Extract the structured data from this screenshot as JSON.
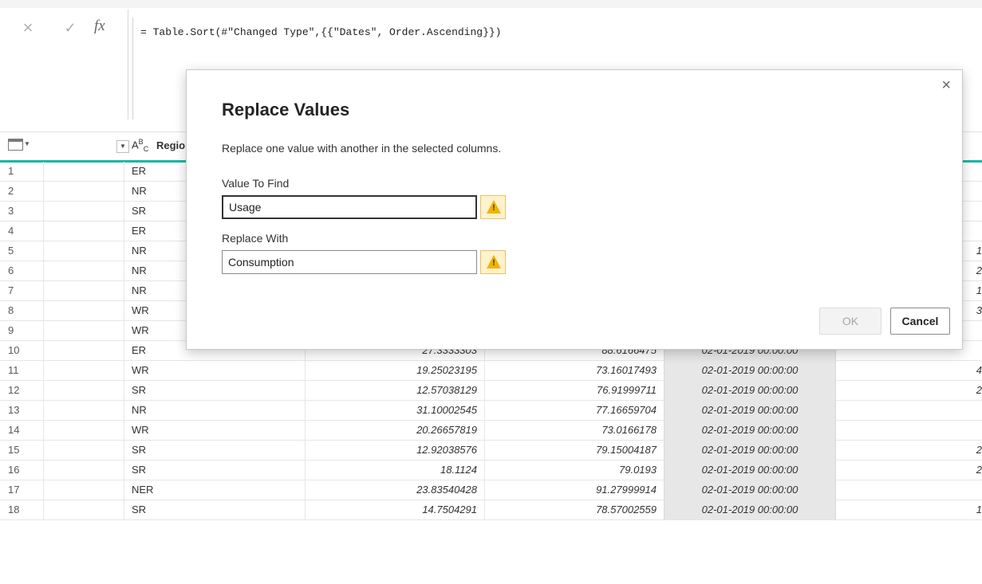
{
  "formula_bar": {
    "cancel_icon": "×",
    "commit_icon": "✓",
    "fx_label": "fx",
    "formula": "= Table.Sort(#\"Changed Type\",{{\"Dates\", Order.Ascending}})"
  },
  "header": {
    "region_type": "ABC",
    "region_label": "Regio"
  },
  "rows": [
    {
      "n": "1",
      "region": "ER",
      "v1": "",
      "v2": "",
      "date": "",
      "last": ""
    },
    {
      "n": "2",
      "region": "NR",
      "v1": "",
      "v2": "",
      "date": "",
      "last": ""
    },
    {
      "n": "3",
      "region": "SR",
      "v1": "",
      "v2": "",
      "date": "",
      "last": ""
    },
    {
      "n": "4",
      "region": "ER",
      "v1": "",
      "v2": "",
      "date": "",
      "last": ""
    },
    {
      "n": "5",
      "region": "NR",
      "v1": "",
      "v2": "",
      "date": "",
      "last": "1"
    },
    {
      "n": "6",
      "region": "NR",
      "v1": "",
      "v2": "",
      "date": "",
      "last": "2"
    },
    {
      "n": "7",
      "region": "NR",
      "v1": "",
      "v2": "",
      "date": "",
      "last": "1"
    },
    {
      "n": "8",
      "region": "WR",
      "v1": "",
      "v2": "",
      "date": "",
      "last": "3"
    },
    {
      "n": "9",
      "region": "WR",
      "v1": "",
      "v2": "",
      "date": "",
      "last": ""
    },
    {
      "n": "10",
      "region": "ER",
      "v1": "27.3333303",
      "v2": "88.6166475",
      "date": "02-01-2019 00:00:00",
      "last": ""
    },
    {
      "n": "11",
      "region": "WR",
      "v1": "19.25023195",
      "v2": "73.16017493",
      "date": "02-01-2019 00:00:00",
      "last": "4"
    },
    {
      "n": "12",
      "region": "SR",
      "v1": "12.57038129",
      "v2": "76.91999711",
      "date": "02-01-2019 00:00:00",
      "last": "2"
    },
    {
      "n": "13",
      "region": "NR",
      "v1": "31.10002545",
      "v2": "77.16659704",
      "date": "02-01-2019 00:00:00",
      "last": ""
    },
    {
      "n": "14",
      "region": "WR",
      "v1": "20.26657819",
      "v2": "73.0166178",
      "date": "02-01-2019 00:00:00",
      "last": ""
    },
    {
      "n": "15",
      "region": "SR",
      "v1": "12.92038576",
      "v2": "79.15004187",
      "date": "02-01-2019 00:00:00",
      "last": "2"
    },
    {
      "n": "16",
      "region": "SR",
      "v1": "18.1124",
      "v2": "79.0193",
      "date": "02-01-2019 00:00:00",
      "last": "2"
    },
    {
      "n": "17",
      "region": "NER",
      "v1": "23.83540428",
      "v2": "91.27999914",
      "date": "02-01-2019 00:00:00",
      "last": ""
    },
    {
      "n": "18",
      "region": "SR",
      "v1": "14.7504291",
      "v2": "78.57002559",
      "date": "02-01-2019 00:00:00",
      "last": "1"
    }
  ],
  "dialog": {
    "close_icon": "×",
    "title": "Replace Values",
    "description": "Replace one value with another in the selected columns.",
    "find_label": "Value To Find",
    "find_value": "Usage",
    "replace_label": "Replace With",
    "replace_value": "Consumption",
    "ok_label": "OK",
    "cancel_label": "Cancel"
  },
  "colors": {
    "accent": "#10b8a4",
    "warning": "#f0b400"
  }
}
